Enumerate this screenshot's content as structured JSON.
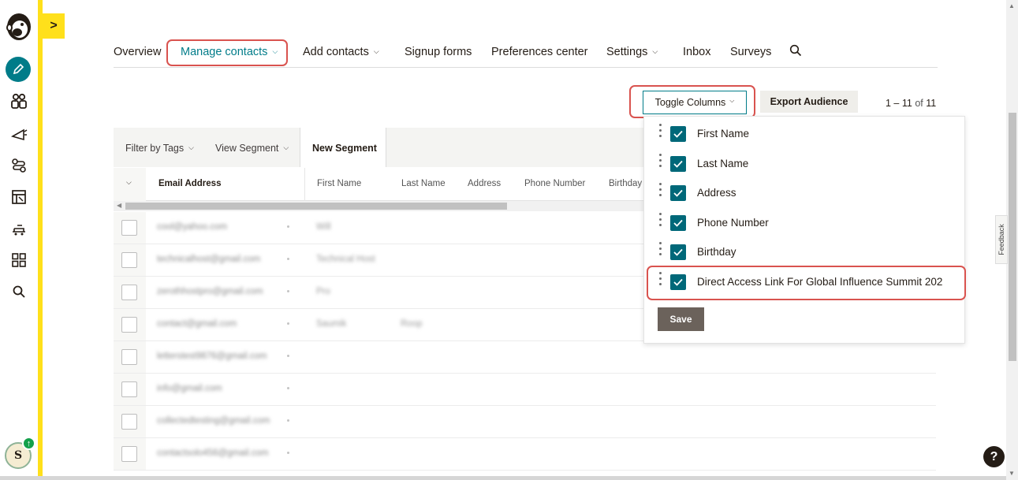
{
  "nav": {
    "items": [
      "Overview",
      "Manage contacts",
      "Add contacts",
      "Signup forms",
      "Preferences center",
      "Settings",
      "Inbox",
      "Surveys"
    ],
    "active": "Manage contacts"
  },
  "rail": {
    "expand_glyph": ">",
    "avatar_initial": "S",
    "badge_glyph": "↑",
    "icons": [
      "mailchimp-logo",
      "pencil-icon",
      "audience-icon",
      "campaigns-icon",
      "automations-icon",
      "content-icon",
      "integrations-icon",
      "apps-grid-icon",
      "search-icon"
    ]
  },
  "toolbar": {
    "toggle_columns": "Toggle Columns",
    "export_audience": "Export Audience",
    "pager_range": "1 – 11",
    "pager_of": "of",
    "pager_total": "11"
  },
  "filterbar": {
    "filter_by_tags": "Filter by Tags",
    "view_segment": "View Segment",
    "new_segment": "New Segment"
  },
  "table": {
    "headers": [
      "Email Address",
      "First Name",
      "Last Name",
      "Address",
      "Phone Number",
      "Birthday"
    ],
    "rows": [
      {
        "email": "cool@yahoo.com",
        "first": "Will",
        "last": ""
      },
      {
        "email": "technicalhost@gmail.com",
        "first": "Technical Host",
        "last": ""
      },
      {
        "email": "zerothhostpro@gmail.com",
        "first": "Pro",
        "last": ""
      },
      {
        "email": "contact@gmail.com",
        "first": "Saumik",
        "last": "Roop"
      },
      {
        "email": "letterstest9876@gmail.com",
        "first": "",
        "last": ""
      },
      {
        "email": "info@gmail.com",
        "first": "",
        "last": ""
      },
      {
        "email": "collectedtesting@gmail.com",
        "first": "",
        "last": ""
      },
      {
        "email": "contactsolo456@gmail.com",
        "first": "",
        "last": ""
      }
    ]
  },
  "column_menu": {
    "options": [
      {
        "label": "First Name",
        "checked": true
      },
      {
        "label": "Last Name",
        "checked": true
      },
      {
        "label": "Address",
        "checked": true
      },
      {
        "label": "Phone Number",
        "checked": true
      },
      {
        "label": "Birthday",
        "checked": true
      },
      {
        "label": "Direct Access Link For Global Influence Summit 202",
        "checked": true
      }
    ],
    "save": "Save"
  },
  "feedback": "Feedback",
  "help": "?",
  "colors": {
    "accent": "#007c89",
    "brand_yellow": "#ffe01b",
    "highlight": "#d9534f",
    "checkbox": "#006879"
  }
}
